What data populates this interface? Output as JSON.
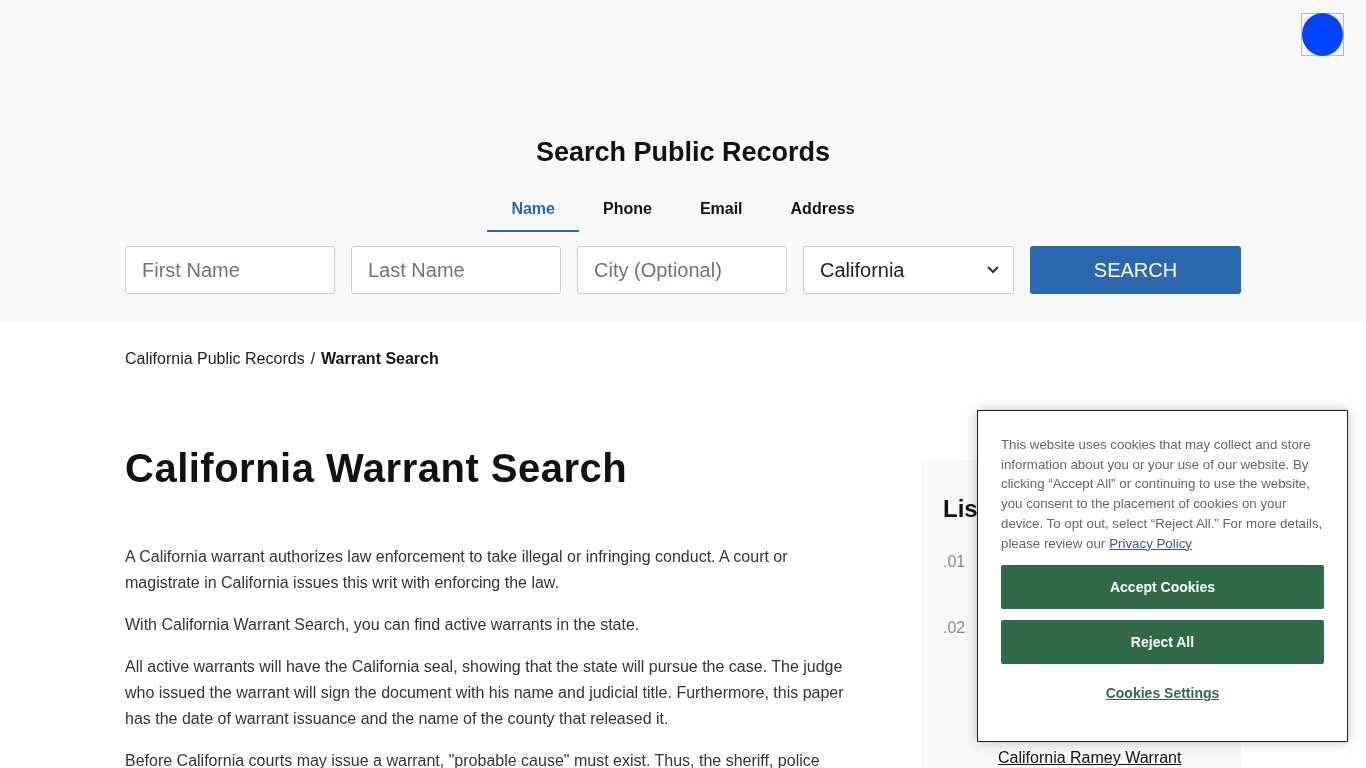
{
  "header": {
    "title": "Search Public Records",
    "tabs": [
      {
        "label": "Name",
        "selected": true
      },
      {
        "label": "Phone",
        "selected": false
      },
      {
        "label": "Email",
        "selected": false
      },
      {
        "label": "Address",
        "selected": false
      }
    ],
    "fields": [
      {
        "placeholder": "First Name"
      },
      {
        "placeholder": "Last Name"
      },
      {
        "placeholder": "City (Optional)"
      }
    ],
    "state_select": {
      "value": "California"
    },
    "search_button": "SEARCH"
  },
  "breadcrumb": [
    {
      "label": "California Public Records",
      "current": false
    },
    {
      "label": "Warrant Search",
      "current": true
    }
  ],
  "breadcrumb_separator": "/",
  "article": {
    "title": "California Warrant Search",
    "paragraphs": [
      "A California warrant authorizes law enforcement to take illegal or infringing conduct. A court or magistrate in California issues this writ with enforcing the law.",
      "With California Warrant Search, you can find active warrants in the state.",
      "All active warrants will have the California seal, showing that the state will pursue the case. The judge who issued the warrant will sign the document with his name and judicial title. Furthermore, this paper has the date of warrant issuance and the name of the county that released it.",
      "Before California courts may issue a warrant, \"probable cause\" must exist. Thus, the sheriff, police"
    ]
  },
  "sidebar": {
    "title": "Lis",
    "items": [
      {
        "number": ".01"
      },
      {
        "number": ".02"
      }
    ],
    "link": "California Ramey Warrant"
  },
  "cookie_banner": {
    "text": "This website uses cookies that may collect and store information about you or your use of our website. By clicking “Accept All” or continuing to use the website, you consent to the placement of cookies on your device. To opt out, select “Reject All.” For more details, please review our",
    "policy_link": "Privacy Policy",
    "accept": "Accept Cookies",
    "reject": "Reject All",
    "settings": "Cookies Settings"
  }
}
